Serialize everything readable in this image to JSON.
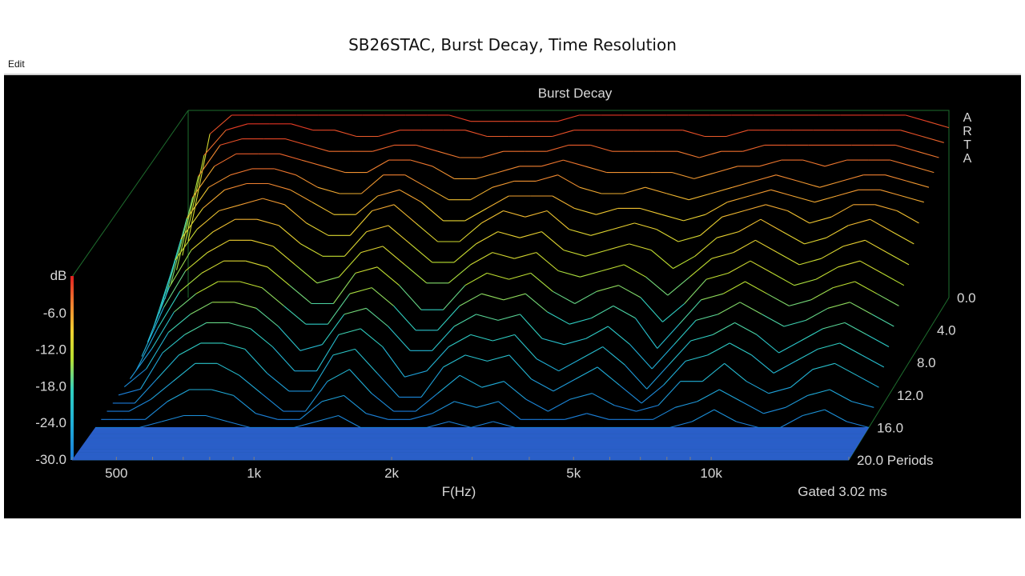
{
  "page": {
    "title": "SB26STAC,  Burst Decay, Time Resolution",
    "edit_label": "Edit"
  },
  "chart_data": {
    "type": "waterfall",
    "title": "Burst Decay",
    "watermark": [
      "A",
      "R",
      "T",
      "A"
    ],
    "xlabel": "F(Hz)",
    "x_scale": "log",
    "x_ticks": [
      "500",
      "1k",
      "2k",
      "5k",
      "10k"
    ],
    "xlim": [
      400,
      20000
    ],
    "z_label": "Periods",
    "z_ticks": [
      "0.0",
      "4.0",
      "8.0",
      "12.0",
      "16.0",
      "20.0 Periods"
    ],
    "zlim": [
      0,
      20
    ],
    "colorbar_label": "dB",
    "colorbar_ticks": [
      "-6.0",
      "-12.0",
      "-18.0",
      "-24.0",
      "-30.0"
    ],
    "ylim": [
      -30,
      0
    ],
    "gated_note": "Gated 3.02 ms",
    "colors": {
      "background": "#000000",
      "frame": "#1e6e2e",
      "text": "#d8d8d8",
      "colormap": [
        "#1a7ad8",
        "#20b0d8",
        "#30d0c0",
        "#b8e030",
        "#f0d030",
        "#f08030",
        "#e02020"
      ]
    },
    "series": [
      {
        "period": 0,
        "values": [
          -21,
          -4,
          -1,
          -1,
          -1,
          -1,
          -1,
          -1,
          -1,
          -1,
          -1,
          -1,
          -1,
          -2,
          -2,
          -2,
          -2,
          -2,
          -1,
          -1,
          -1,
          -1,
          -1,
          -1,
          -1,
          -1,
          -1,
          -1,
          -1,
          -1,
          -1,
          -1,
          -1,
          -1,
          -2,
          -3
        ]
      },
      {
        "period": 1,
        "values": [
          -22,
          -6,
          -2,
          -1,
          -1,
          -1,
          -2,
          -2,
          -3,
          -3,
          -2,
          -2,
          -2,
          -2,
          -3,
          -3,
          -3,
          -3,
          -2,
          -2,
          -2,
          -2,
          -2,
          -2,
          -3,
          -3,
          -2,
          -2,
          -2,
          -2,
          -2,
          -2,
          -2,
          -2,
          -3,
          -4
        ]
      },
      {
        "period": 2,
        "values": [
          -23,
          -8,
          -3,
          -2,
          -2,
          -2,
          -3,
          -4,
          -4,
          -4,
          -3,
          -3,
          -4,
          -5,
          -5,
          -4,
          -4,
          -4,
          -3,
          -3,
          -4,
          -4,
          -4,
          -4,
          -5,
          -4,
          -4,
          -3,
          -3,
          -3,
          -3,
          -3,
          -3,
          -3,
          -4,
          -5
        ]
      },
      {
        "period": 3,
        "values": [
          -24,
          -10,
          -5,
          -3,
          -3,
          -3,
          -4,
          -5,
          -6,
          -6,
          -4,
          -4,
          -5,
          -7,
          -7,
          -6,
          -5,
          -5,
          -4,
          -5,
          -6,
          -6,
          -6,
          -6,
          -7,
          -6,
          -5,
          -5,
          -4,
          -4,
          -5,
          -4,
          -4,
          -4,
          -5,
          -6
        ]
      },
      {
        "period": 4,
        "values": [
          -25,
          -12,
          -7,
          -5,
          -4,
          -4,
          -5,
          -7,
          -8,
          -8,
          -5,
          -5,
          -7,
          -9,
          -9,
          -7,
          -6,
          -6,
          -5,
          -7,
          -8,
          -8,
          -7,
          -8,
          -9,
          -8,
          -7,
          -6,
          -5,
          -6,
          -7,
          -6,
          -5,
          -5,
          -6,
          -7
        ]
      },
      {
        "period": 5,
        "values": [
          -26,
          -14,
          -9,
          -6,
          -5,
          -5,
          -6,
          -8,
          -10,
          -10,
          -7,
          -6,
          -8,
          -11,
          -11,
          -9,
          -7,
          -7,
          -7,
          -9,
          -10,
          -9,
          -9,
          -10,
          -11,
          -10,
          -8,
          -7,
          -6,
          -7,
          -8,
          -7,
          -6,
          -6,
          -7,
          -8
        ]
      },
      {
        "period": 6,
        "values": [
          -27,
          -16,
          -11,
          -8,
          -7,
          -6,
          -7,
          -10,
          -12,
          -12,
          -8,
          -7,
          -10,
          -13,
          -13,
          -10,
          -8,
          -9,
          -8,
          -11,
          -12,
          -11,
          -10,
          -11,
          -13,
          -12,
          -9,
          -8,
          -7,
          -8,
          -10,
          -9,
          -7,
          -7,
          -8,
          -10
        ]
      },
      {
        "period": 7,
        "values": [
          -28,
          -19,
          -13,
          -10,
          -8,
          -8,
          -9,
          -12,
          -14,
          -14,
          -10,
          -9,
          -12,
          -15,
          -15,
          -12,
          -10,
          -11,
          -10,
          -13,
          -14,
          -13,
          -12,
          -13,
          -16,
          -14,
          -11,
          -10,
          -8,
          -10,
          -12,
          -11,
          -9,
          -8,
          -10,
          -12
        ]
      },
      {
        "period": 8,
        "values": [
          -29,
          -21,
          -15,
          -12,
          -10,
          -10,
          -11,
          -14,
          -17,
          -16,
          -12,
          -11,
          -14,
          -17,
          -17,
          -14,
          -12,
          -13,
          -12,
          -15,
          -16,
          -15,
          -14,
          -16,
          -19,
          -16,
          -13,
          -12,
          -10,
          -12,
          -14,
          -13,
          -11,
          -10,
          -12,
          -14
        ]
      },
      {
        "period": 9,
        "values": [
          -30,
          -23,
          -17,
          -14,
          -12,
          -12,
          -13,
          -16,
          -19,
          -19,
          -14,
          -13,
          -16,
          -20,
          -20,
          -16,
          -14,
          -15,
          -14,
          -17,
          -19,
          -17,
          -16,
          -18,
          -22,
          -19,
          -15,
          -14,
          -12,
          -14,
          -16,
          -15,
          -13,
          -12,
          -14,
          -16
        ]
      },
      {
        "period": 10,
        "values": [
          -30,
          -25,
          -19,
          -16,
          -14,
          -14,
          -15,
          -18,
          -21,
          -21,
          -16,
          -15,
          -18,
          -22,
          -22,
          -18,
          -16,
          -17,
          -16,
          -19,
          -21,
          -20,
          -18,
          -20,
          -25,
          -21,
          -17,
          -16,
          -14,
          -16,
          -18,
          -17,
          -15,
          -14,
          -16,
          -18
        ]
      },
      {
        "period": 11,
        "values": [
          -30,
          -27,
          -21,
          -18,
          -16,
          -16,
          -17,
          -20,
          -24,
          -23,
          -18,
          -17,
          -20,
          -24,
          -24,
          -20,
          -18,
          -19,
          -18,
          -22,
          -23,
          -22,
          -20,
          -23,
          -27,
          -23,
          -19,
          -18,
          -16,
          -18,
          -20,
          -19,
          -17,
          -16,
          -18,
          -20
        ]
      },
      {
        "period": 12,
        "values": [
          -30,
          -29,
          -23,
          -20,
          -18,
          -18,
          -19,
          -22,
          -26,
          -26,
          -20,
          -19,
          -22,
          -27,
          -26,
          -22,
          -20,
          -21,
          -20,
          -24,
          -26,
          -24,
          -22,
          -25,
          -29,
          -25,
          -21,
          -20,
          -18,
          -20,
          -23,
          -21,
          -19,
          -18,
          -20,
          -22
        ]
      },
      {
        "period": 13,
        "values": [
          -30,
          -30,
          -26,
          -22,
          -20,
          -20,
          -21,
          -25,
          -28,
          -28,
          -22,
          -21,
          -25,
          -29,
          -29,
          -24,
          -22,
          -23,
          -22,
          -26,
          -28,
          -26,
          -24,
          -27,
          -30,
          -27,
          -23,
          -22,
          -20,
          -22,
          -25,
          -23,
          -21,
          -20,
          -22,
          -24
        ]
      },
      {
        "period": 14,
        "values": [
          -30,
          -30,
          -28,
          -25,
          -22,
          -22,
          -24,
          -27,
          -30,
          -30,
          -25,
          -23,
          -27,
          -30,
          -30,
          -27,
          -24,
          -26,
          -25,
          -28,
          -30,
          -28,
          -27,
          -29,
          -30,
          -29,
          -25,
          -25,
          -22,
          -25,
          -27,
          -26,
          -23,
          -22,
          -24,
          -26
        ]
      },
      {
        "period": 15,
        "values": [
          -30,
          -30,
          -30,
          -27,
          -25,
          -25,
          -26,
          -29,
          -30,
          -30,
          -27,
          -26,
          -29,
          -30,
          -30,
          -29,
          -27,
          -28,
          -27,
          -30,
          -30,
          -30,
          -29,
          -30,
          -30,
          -30,
          -28,
          -27,
          -25,
          -27,
          -29,
          -28,
          -26,
          -25,
          -27,
          -28
        ]
      },
      {
        "period": 16,
        "values": [
          -30,
          -30,
          -30,
          -29,
          -28,
          -28,
          -29,
          -30,
          -30,
          -30,
          -29,
          -28,
          -30,
          -30,
          -30,
          -30,
          -29,
          -30,
          -29,
          -30,
          -30,
          -30,
          -30,
          -30,
          -30,
          -30,
          -30,
          -29,
          -27,
          -29,
          -30,
          -30,
          -28,
          -27,
          -29,
          -30
        ]
      }
    ]
  }
}
